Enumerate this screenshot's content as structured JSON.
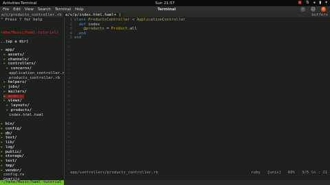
{
  "gnome_topbar": {
    "activities": "Activities",
    "app": "Terminal",
    "clock": "Sun 21:57"
  },
  "window": {
    "title": "Terminal",
    "menu": [
      "File",
      "Edit",
      "View",
      "Search",
      "Terminal",
      "Help"
    ]
  },
  "vim": {
    "tab_left": "a/c/products_controller.rb",
    "tab_right": "a/v/p/index.html.haml+ |",
    "buffers_label": "buffers",
    "tree_help": "\" Press ? for help",
    "tree_top": "..(up a dir)",
    "tree_root": "<ehe/Music/haml-tutorial/",
    "tree": [
      {
        "t": "app/",
        "kind": "dir",
        "indent": 0
      },
      {
        "t": "assets/",
        "kind": "dir",
        "indent": 1
      },
      {
        "t": "channels/",
        "kind": "dir",
        "indent": 1
      },
      {
        "t": "controllers/",
        "kind": "dir",
        "indent": 1
      },
      {
        "t": "concerns/",
        "kind": "dir",
        "indent": 2
      },
      {
        "t": "application_controller.rb",
        "kind": "file",
        "indent": 3
      },
      {
        "t": "products_controller.rb",
        "kind": "file",
        "indent": 3
      },
      {
        "t": "helpers/",
        "kind": "dir",
        "indent": 1
      },
      {
        "t": "jobs/",
        "kind": "dir",
        "indent": 1
      },
      {
        "t": "mailers/",
        "kind": "dir",
        "indent": 1
      },
      {
        "t": "models/",
        "kind": "dir",
        "indent": 1
      },
      {
        "t": "views/",
        "kind": "dir",
        "indent": 1
      },
      {
        "t": "layouts/",
        "kind": "dir",
        "indent": 2
      },
      {
        "t": "products/",
        "kind": "dir",
        "indent": 2
      },
      {
        "t": "index.html.haml",
        "kind": "file",
        "indent": 3
      },
      {
        "t": "",
        "kind": "blank",
        "indent": 0
      },
      {
        "t": "bin/",
        "kind": "dir",
        "indent": 0
      },
      {
        "t": "config/",
        "kind": "dir",
        "indent": 0
      },
      {
        "t": "db/",
        "kind": "dir",
        "indent": 0
      },
      {
        "t": "test/",
        "kind": "dir",
        "indent": 0
      },
      {
        "t": "lib/",
        "kind": "dir",
        "indent": 0
      },
      {
        "t": "log/",
        "kind": "dir",
        "indent": 0
      },
      {
        "t": "public/",
        "kind": "dir",
        "indent": 0
      },
      {
        "t": "storage/",
        "kind": "dir",
        "indent": 0
      },
      {
        "t": "test/",
        "kind": "dir",
        "indent": 0
      },
      {
        "t": "tmp/",
        "kind": "dir",
        "indent": 0
      },
      {
        "t": "vendor/",
        "kind": "dir",
        "indent": 0
      },
      {
        "t": "config.ru",
        "kind": "file",
        "indent": 1
      },
      {
        "t": "Gemfile",
        "kind": "file",
        "indent": 1
      }
    ],
    "code": [
      [
        {
          "c": "kw",
          "t": "class "
        },
        {
          "c": "cl",
          "t": "ProductsController"
        },
        {
          "c": "tx",
          "t": " < "
        },
        {
          "c": "cl",
          "t": "ApplicationController"
        }
      ],
      [
        {
          "c": "tx",
          "t": "  "
        },
        {
          "c": "kw",
          "t": "def "
        },
        {
          "c": "tx",
          "t": "index"
        }
      ],
      [
        {
          "c": "tx",
          "t": "    "
        },
        {
          "c": "iv",
          "t": "@products"
        },
        {
          "c": "tx",
          "t": " = "
        },
        {
          "c": "cl",
          "t": "Product"
        },
        {
          "c": "tx",
          "t": ".all"
        }
      ],
      [
        {
          "c": "tx",
          "t": "  "
        },
        {
          "c": "kw",
          "t": "end"
        }
      ],
      [
        {
          "c": "kw",
          "t": "end"
        }
      ]
    ],
    "line_numbers": [
      "1",
      "2",
      "3",
      "4",
      "5"
    ],
    "status_path": "app/controllers/products_controller.rb",
    "status_ft": "ruby",
    "status_enc": "[unix]",
    "status_pct": "60%",
    "status_pos": "3/5 ln : 21",
    "bottom_path": "~/hehe/Music/haml-tutorial"
  }
}
